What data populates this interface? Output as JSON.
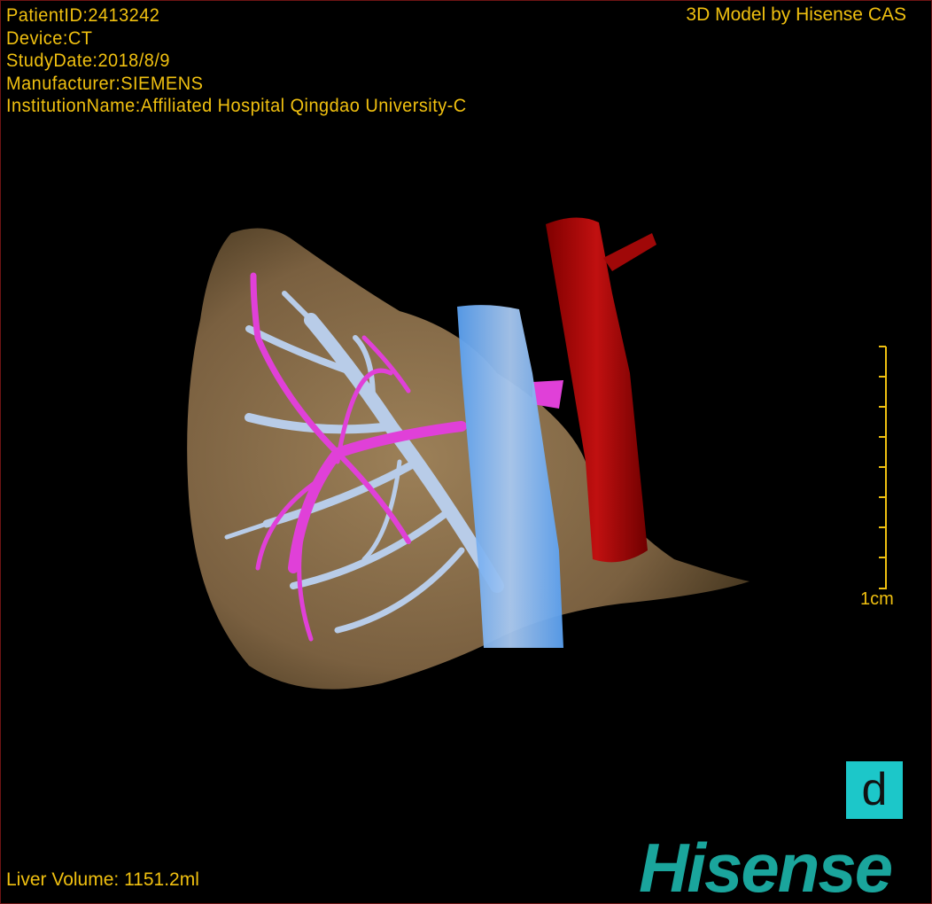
{
  "overlay": {
    "patient_id": "PatientID:2413242",
    "device": "Device:CT",
    "study_date": "StudyDate:2018/8/9",
    "manufacturer": "Manufacturer:SIEMENS",
    "institution": "InstitutionName:Affiliated Hospital Qingdao University-C",
    "brand_caption": "3D Model by Hisense CAS",
    "liver_volume": "Liver Volume: 1151.2ml",
    "scale_label": "1cm"
  },
  "logo": {
    "text": "Hisense",
    "color": "#1aa59c"
  },
  "d_button": {
    "label": "d",
    "color": "#1cc7c9"
  },
  "colors": {
    "text": "#f0c010",
    "liver": "#8b7048",
    "portal_vein": "#b8cce8",
    "hepatic_vein": "#e040d8",
    "ivc": "#5fa8f0",
    "aorta": "#b00808",
    "border": "#6e1414"
  }
}
